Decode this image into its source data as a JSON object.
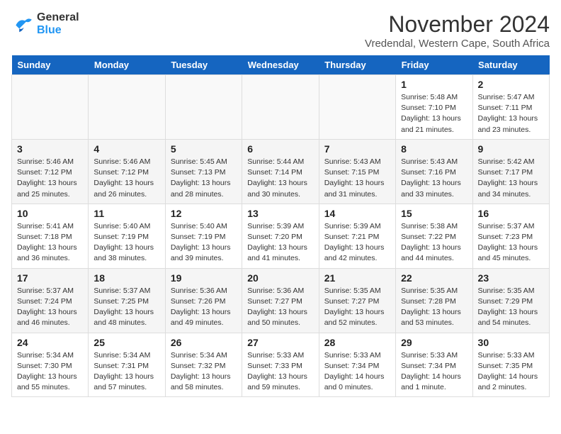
{
  "logo": {
    "line1": "General",
    "line2": "Blue"
  },
  "title": "November 2024",
  "location": "Vredendal, Western Cape, South Africa",
  "days_of_week": [
    "Sunday",
    "Monday",
    "Tuesday",
    "Wednesday",
    "Thursday",
    "Friday",
    "Saturday"
  ],
  "weeks": [
    [
      {
        "day": "",
        "info": "",
        "empty": true
      },
      {
        "day": "",
        "info": "",
        "empty": true
      },
      {
        "day": "",
        "info": "",
        "empty": true
      },
      {
        "day": "",
        "info": "",
        "empty": true
      },
      {
        "day": "",
        "info": "",
        "empty": true
      },
      {
        "day": "1",
        "info": "Sunrise: 5:48 AM\nSunset: 7:10 PM\nDaylight: 13 hours\nand 21 minutes."
      },
      {
        "day": "2",
        "info": "Sunrise: 5:47 AM\nSunset: 7:11 PM\nDaylight: 13 hours\nand 23 minutes."
      }
    ],
    [
      {
        "day": "3",
        "info": "Sunrise: 5:46 AM\nSunset: 7:12 PM\nDaylight: 13 hours\nand 25 minutes."
      },
      {
        "day": "4",
        "info": "Sunrise: 5:46 AM\nSunset: 7:12 PM\nDaylight: 13 hours\nand 26 minutes."
      },
      {
        "day": "5",
        "info": "Sunrise: 5:45 AM\nSunset: 7:13 PM\nDaylight: 13 hours\nand 28 minutes."
      },
      {
        "day": "6",
        "info": "Sunrise: 5:44 AM\nSunset: 7:14 PM\nDaylight: 13 hours\nand 30 minutes."
      },
      {
        "day": "7",
        "info": "Sunrise: 5:43 AM\nSunset: 7:15 PM\nDaylight: 13 hours\nand 31 minutes."
      },
      {
        "day": "8",
        "info": "Sunrise: 5:43 AM\nSunset: 7:16 PM\nDaylight: 13 hours\nand 33 minutes."
      },
      {
        "day": "9",
        "info": "Sunrise: 5:42 AM\nSunset: 7:17 PM\nDaylight: 13 hours\nand 34 minutes."
      }
    ],
    [
      {
        "day": "10",
        "info": "Sunrise: 5:41 AM\nSunset: 7:18 PM\nDaylight: 13 hours\nand 36 minutes."
      },
      {
        "day": "11",
        "info": "Sunrise: 5:40 AM\nSunset: 7:19 PM\nDaylight: 13 hours\nand 38 minutes."
      },
      {
        "day": "12",
        "info": "Sunrise: 5:40 AM\nSunset: 7:19 PM\nDaylight: 13 hours\nand 39 minutes."
      },
      {
        "day": "13",
        "info": "Sunrise: 5:39 AM\nSunset: 7:20 PM\nDaylight: 13 hours\nand 41 minutes."
      },
      {
        "day": "14",
        "info": "Sunrise: 5:39 AM\nSunset: 7:21 PM\nDaylight: 13 hours\nand 42 minutes."
      },
      {
        "day": "15",
        "info": "Sunrise: 5:38 AM\nSunset: 7:22 PM\nDaylight: 13 hours\nand 44 minutes."
      },
      {
        "day": "16",
        "info": "Sunrise: 5:37 AM\nSunset: 7:23 PM\nDaylight: 13 hours\nand 45 minutes."
      }
    ],
    [
      {
        "day": "17",
        "info": "Sunrise: 5:37 AM\nSunset: 7:24 PM\nDaylight: 13 hours\nand 46 minutes."
      },
      {
        "day": "18",
        "info": "Sunrise: 5:37 AM\nSunset: 7:25 PM\nDaylight: 13 hours\nand 48 minutes."
      },
      {
        "day": "19",
        "info": "Sunrise: 5:36 AM\nSunset: 7:26 PM\nDaylight: 13 hours\nand 49 minutes."
      },
      {
        "day": "20",
        "info": "Sunrise: 5:36 AM\nSunset: 7:27 PM\nDaylight: 13 hours\nand 50 minutes."
      },
      {
        "day": "21",
        "info": "Sunrise: 5:35 AM\nSunset: 7:27 PM\nDaylight: 13 hours\nand 52 minutes."
      },
      {
        "day": "22",
        "info": "Sunrise: 5:35 AM\nSunset: 7:28 PM\nDaylight: 13 hours\nand 53 minutes."
      },
      {
        "day": "23",
        "info": "Sunrise: 5:35 AM\nSunset: 7:29 PM\nDaylight: 13 hours\nand 54 minutes."
      }
    ],
    [
      {
        "day": "24",
        "info": "Sunrise: 5:34 AM\nSunset: 7:30 PM\nDaylight: 13 hours\nand 55 minutes."
      },
      {
        "day": "25",
        "info": "Sunrise: 5:34 AM\nSunset: 7:31 PM\nDaylight: 13 hours\nand 57 minutes."
      },
      {
        "day": "26",
        "info": "Sunrise: 5:34 AM\nSunset: 7:32 PM\nDaylight: 13 hours\nand 58 minutes."
      },
      {
        "day": "27",
        "info": "Sunrise: 5:33 AM\nSunset: 7:33 PM\nDaylight: 13 hours\nand 59 minutes."
      },
      {
        "day": "28",
        "info": "Sunrise: 5:33 AM\nSunset: 7:34 PM\nDaylight: 14 hours\nand 0 minutes."
      },
      {
        "day": "29",
        "info": "Sunrise: 5:33 AM\nSunset: 7:34 PM\nDaylight: 14 hours\nand 1 minute."
      },
      {
        "day": "30",
        "info": "Sunrise: 5:33 AM\nSunset: 7:35 PM\nDaylight: 14 hours\nand 2 minutes."
      }
    ]
  ]
}
